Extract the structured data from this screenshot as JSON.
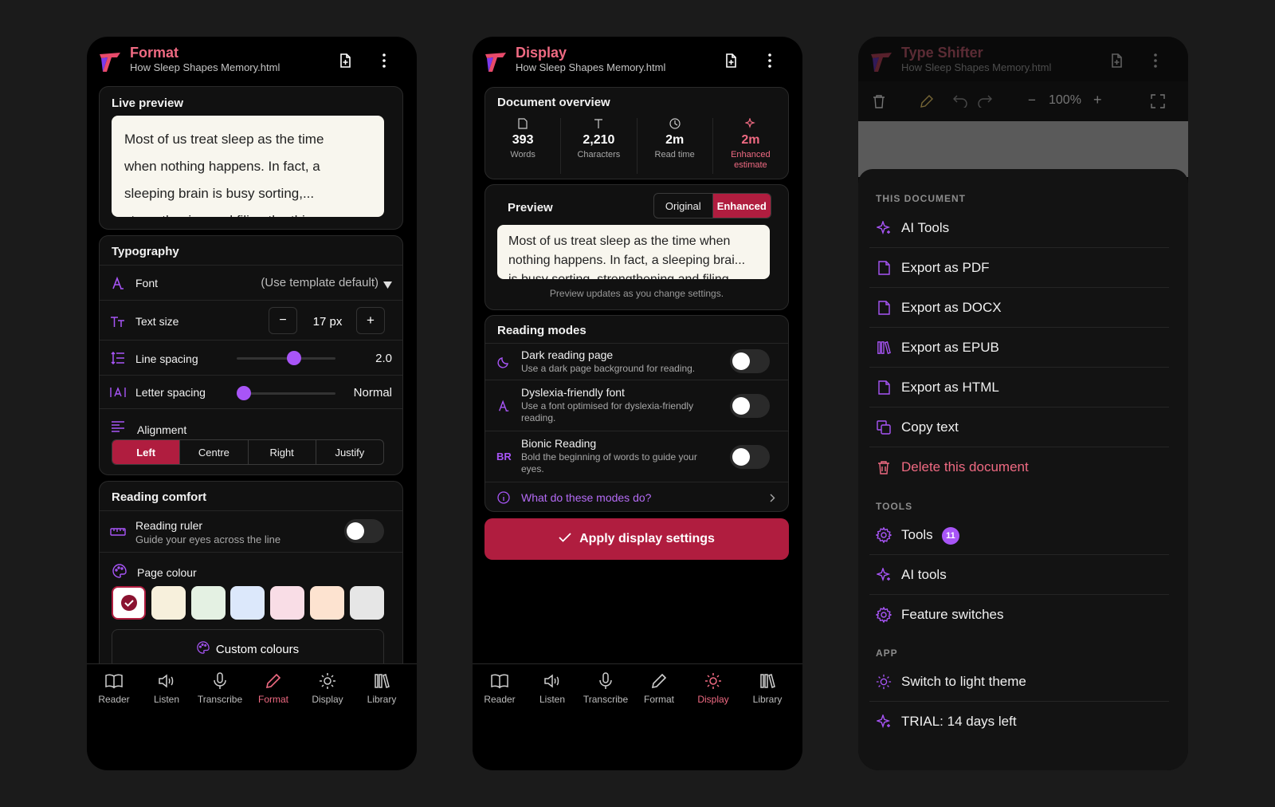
{
  "file_name": "How Sleep Shapes Memory.html",
  "nav": [
    "Reader",
    "Listen",
    "Transcribe",
    "Format",
    "Display",
    "Library"
  ],
  "format_panel": {
    "title": "Format",
    "live_preview": {
      "heading": "Live preview",
      "line1": "Most of us treat sleep as the time",
      "line2": "when nothing happens. In fact, a",
      "line3": "sleeping brain is busy sorting,...",
      "line4": "strengthening and filing the things"
    },
    "typography": {
      "heading": "Typography",
      "font_label": "Font",
      "font_value": "(Use template default)",
      "text_size_label": "Text size",
      "text_size_value": "17 px",
      "minus": "−",
      "plus": "+",
      "line_spacing_label": "Line spacing",
      "line_spacing_value": "2.0",
      "letter_spacing_label": "Letter spacing",
      "letter_spacing_value": "Normal",
      "alignment_label": "Alignment",
      "alignment_options": [
        "Left",
        "Centre",
        "Right",
        "Justify"
      ]
    },
    "reading_comfort": {
      "heading": "Reading comfort",
      "ruler_label": "Reading ruler",
      "ruler_desc": "Guide your eyes across the line",
      "page_colour_label": "Page colour",
      "swatches": [
        "#ffffff",
        "#f7f0dc",
        "#e4f1e3",
        "#dce8fb",
        "#f9dde6",
        "#fde3d0",
        "#e6e6e6"
      ],
      "custom_colours": "Custom colours"
    }
  },
  "display_panel": {
    "title": "Display",
    "overview": {
      "heading": "Document overview",
      "stats": [
        {
          "value": "393",
          "label": "Words"
        },
        {
          "value": "2,210",
          "label": "Characters"
        },
        {
          "value": "2m",
          "label": "Read time"
        },
        {
          "value": "2m",
          "label": "Enhanced estimate"
        }
      ]
    },
    "preview": {
      "heading": "Preview",
      "toggle_original": "Original",
      "toggle_enhanced": "Enhanced",
      "line1": "Most of us treat sleep as the time when",
      "line2": "nothing happens. In fact, a sleeping brai...",
      "line3": "is busy sorting, strengthening and filing",
      "note": "Preview updates as you change settings."
    },
    "reading_modes": {
      "heading": "Reading modes",
      "modes": [
        {
          "title": "Dark reading page",
          "desc": "Use a dark page background for reading."
        },
        {
          "title": "Dyslexia-friendly font",
          "desc1": "Use a font optimised for dyslexia-friendly",
          "desc2": "reading."
        },
        {
          "title": "Bionic Reading",
          "desc1": "Bold the beginning of words to guide your",
          "desc2": "eyes."
        }
      ],
      "bionic_icon_text": "BR",
      "help_link": "What do these modes do?"
    },
    "apply_button": "Apply display settings"
  },
  "menu_panel": {
    "title": "Type Shifter",
    "zoom": "100%",
    "sections": {
      "this_document": "THIS DOCUMENT",
      "tools": "TOOLS",
      "app": "APP"
    },
    "doc_items": [
      "AI Tools",
      "Export as PDF",
      "Export as DOCX",
      "Export as EPUB",
      "Export as HTML",
      "Copy text",
      "Delete this document"
    ],
    "tools_items": [
      "Tools",
      "AI tools",
      "Feature switches"
    ],
    "tools_badge": "11",
    "app_items": [
      "Switch to light theme",
      "TRIAL: 14 days left"
    ]
  },
  "colors": {
    "accent": "#b01d3f",
    "pink": "#ef6a82",
    "purple": "#a855f7"
  }
}
